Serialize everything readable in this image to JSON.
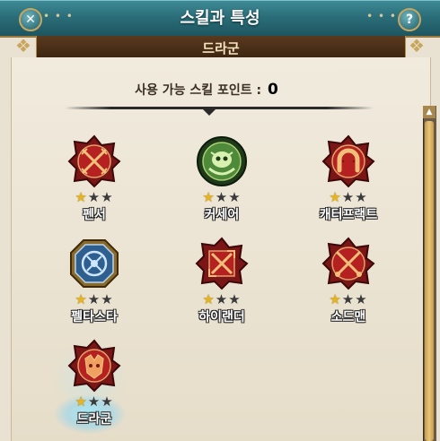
{
  "window": {
    "title": "스킬과 특성",
    "close_symbol": "✕",
    "help_symbol": "?"
  },
  "class_name": "드라군",
  "skill_points": {
    "label": "사용 가능 스킬 포인트 :",
    "value": "0"
  },
  "colors": {
    "star_filled": "#e6b422",
    "star_empty": "#3a3a3a",
    "title_bar": "#2b6f7a",
    "selected_glow": "#8fe6ff"
  },
  "skills": [
    {
      "name": "펜서",
      "icon": "crossed-lances-icon",
      "stars": 1,
      "max_stars": 3
    },
    {
      "name": "커세어",
      "icon": "corsair-skull-icon",
      "stars": 1,
      "max_stars": 3
    },
    {
      "name": "캐터프랙트",
      "icon": "horseshoe-icon",
      "stars": 1,
      "max_stars": 3
    },
    {
      "name": "펠타스타",
      "icon": "shield-knot-icon",
      "stars": 1,
      "max_stars": 3
    },
    {
      "name": "하이랜더",
      "icon": "crossed-swords-icon",
      "stars": 1,
      "max_stars": 3
    },
    {
      "name": "소드맨",
      "icon": "crossed-blades-icon",
      "stars": 1,
      "max_stars": 3
    },
    {
      "name": "드라군",
      "icon": "dragon-helm-icon",
      "stars": 1,
      "max_stars": 3,
      "selected": true
    }
  ]
}
